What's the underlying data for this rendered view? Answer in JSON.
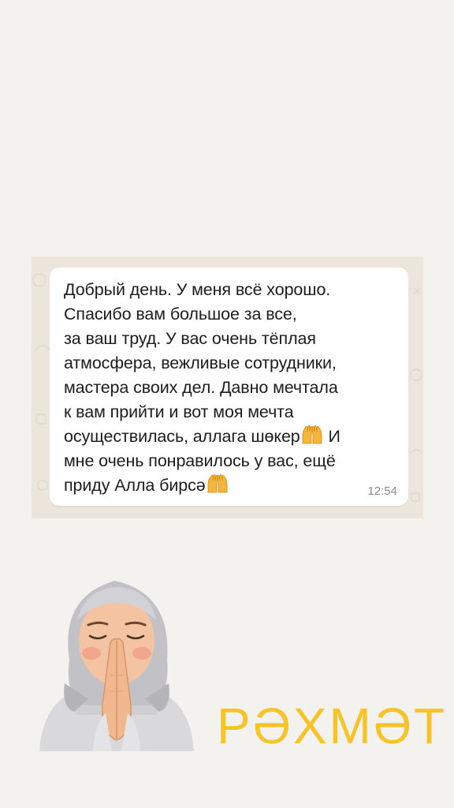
{
  "chat": {
    "message": "Добрый день. У меня всё хорошо.\nСпасибо вам большое за все,\nза ваш труд. У вас очень тёплая\nатмосфера, вежливые сотрудники,\nмастера своих дел. Давно мечтала\nк вам прийти и вот моя мечта",
    "message_line7_a": "осуществилась, аллага шөкер",
    "message_line7_b": " И",
    "message_line8": "мне очень понравилось у вас, ещё",
    "message_line9": "приду Алла бирсә",
    "time": "12:54",
    "emoji": "raised-hands-icon"
  },
  "caption": {
    "text": "РӘХМӘТ",
    "color": "#f7c327"
  },
  "avatar": {
    "icon": "praying-memoji-avatar"
  },
  "colors": {
    "background": "#f4f2ef",
    "chat_wallpaper": "#ece5dc",
    "bubble": "#ffffff"
  }
}
